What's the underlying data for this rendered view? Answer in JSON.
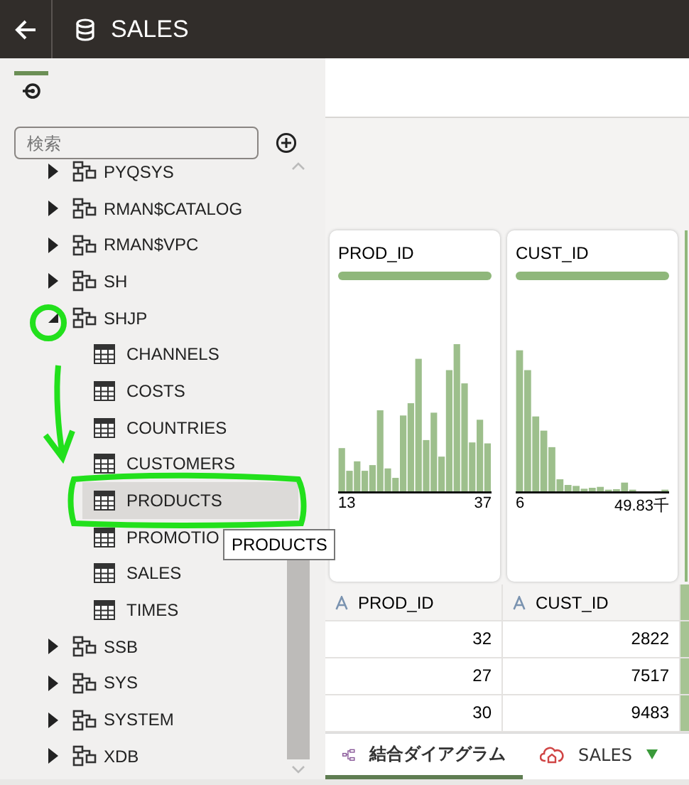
{
  "header": {
    "title": "SALES"
  },
  "sidebar": {
    "search": {
      "placeholder": "検索"
    },
    "tree": [
      {
        "label": "PYQSYS",
        "kind": "schema",
        "expanded": false,
        "selected": false
      },
      {
        "label": "RMAN$CATALOG",
        "kind": "schema",
        "expanded": false,
        "selected": false
      },
      {
        "label": "RMAN$VPC",
        "kind": "schema",
        "expanded": false,
        "selected": false
      },
      {
        "label": "SH",
        "kind": "schema",
        "expanded": false,
        "selected": false
      },
      {
        "label": "SHJP",
        "kind": "schema",
        "expanded": true,
        "selected": false,
        "children": [
          {
            "label": "CHANNELS",
            "kind": "table",
            "selected": false
          },
          {
            "label": "COSTS",
            "kind": "table",
            "selected": false
          },
          {
            "label": "COUNTRIES",
            "kind": "table",
            "selected": false
          },
          {
            "label": "CUSTOMERS",
            "kind": "table",
            "selected": false
          },
          {
            "label": "PRODUCTS",
            "kind": "table",
            "selected": true
          },
          {
            "label": "PROMOTIO",
            "kind": "table",
            "selected": false
          },
          {
            "label": "SALES",
            "kind": "table",
            "selected": false
          },
          {
            "label": "TIMES",
            "kind": "table",
            "selected": false
          }
        ]
      },
      {
        "label": "SSB",
        "kind": "schema",
        "expanded": false,
        "selected": false
      },
      {
        "label": "SYS",
        "kind": "schema",
        "expanded": false,
        "selected": false
      },
      {
        "label": "SYSTEM",
        "kind": "schema",
        "expanded": false,
        "selected": false
      },
      {
        "label": "XDB",
        "kind": "schema",
        "expanded": false,
        "selected": false
      }
    ],
    "tooltip": "PRODUCTS"
  },
  "columns": [
    {
      "title": "PROD_ID",
      "min": "13",
      "max": "37",
      "header": "PROD_ID"
    },
    {
      "title": "CUST_ID",
      "min": "6",
      "max": "49.83千",
      "header": "CUST_ID"
    }
  ],
  "rows": [
    [
      "32",
      "2822"
    ],
    [
      "27",
      "7517"
    ],
    [
      "30",
      "9483"
    ]
  ],
  "tabs": [
    {
      "label": "結合ダイアグラム",
      "kind": "diagram",
      "selected": true
    },
    {
      "label": "SALES",
      "kind": "source",
      "selected": false
    }
  ]
}
